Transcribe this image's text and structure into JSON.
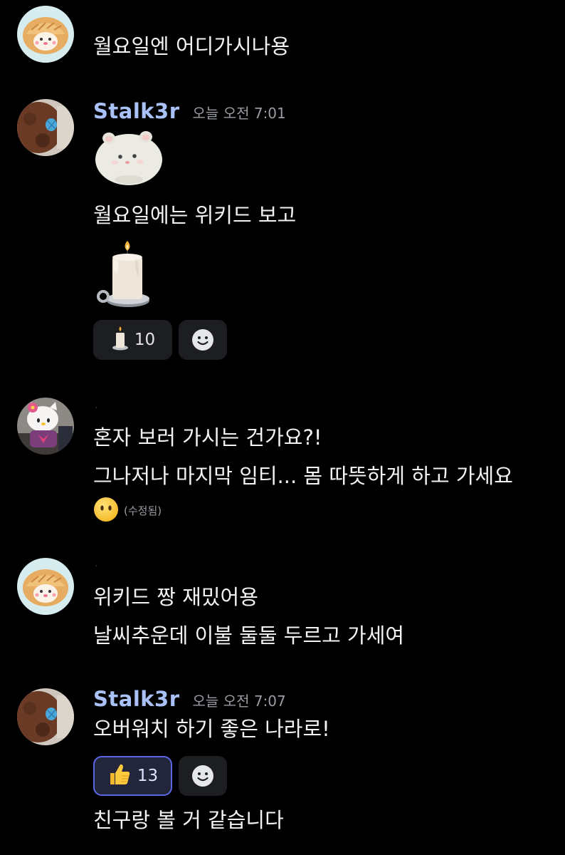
{
  "messages": [
    {
      "avatar": "hamster-bread-avatar",
      "lines": [
        "월요일엔 어디가시나용"
      ]
    },
    {
      "username": "Stalk3r",
      "timestamp": "오늘 오전 7:01",
      "avatar": "plush-toy-avatar",
      "sticker": "white-hamster-sticker",
      "lines": [
        "월요일에는 위키드 보고"
      ],
      "emoji": "candle-emoji",
      "reactions": [
        {
          "emoji": "candle-emoji",
          "count": "10",
          "active": false
        }
      ]
    },
    {
      "username_stub": "·",
      "avatar": "hello-kitty-avatar",
      "lines": [
        "혼자 보러 가시는 건가요?!",
        "그나저나 마지막 임티... 몸 따뜻하게 하고 가세요"
      ],
      "inline_emoji": "no-mouth-face-emoji",
      "edited_label": "(수정됨)"
    },
    {
      "username_stub": "·",
      "avatar": "hamster-bread-avatar",
      "lines": [
        "위키드 짱 재밌어용",
        "날씨추운데 이불 둘둘 두르고 가세여"
      ]
    },
    {
      "username": "Stalk3r",
      "timestamp": "오늘 오전 7:07",
      "avatar": "plush-toy-avatar",
      "lines": [
        "오버워치 하기 좋은 나라로!",
        "친구랑 볼 거 같습니다"
      ],
      "reactions": [
        {
          "emoji": "thumbs-up-emoji",
          "count": "13",
          "active": true
        }
      ]
    }
  ],
  "colors": {
    "background": "#000000",
    "username": "#a9c1f7",
    "timestamp": "#9a9ca3",
    "message_text": "#f2f3f5",
    "reaction_bg": "#1d1e22",
    "reaction_active_border": "#5b66e6"
  }
}
